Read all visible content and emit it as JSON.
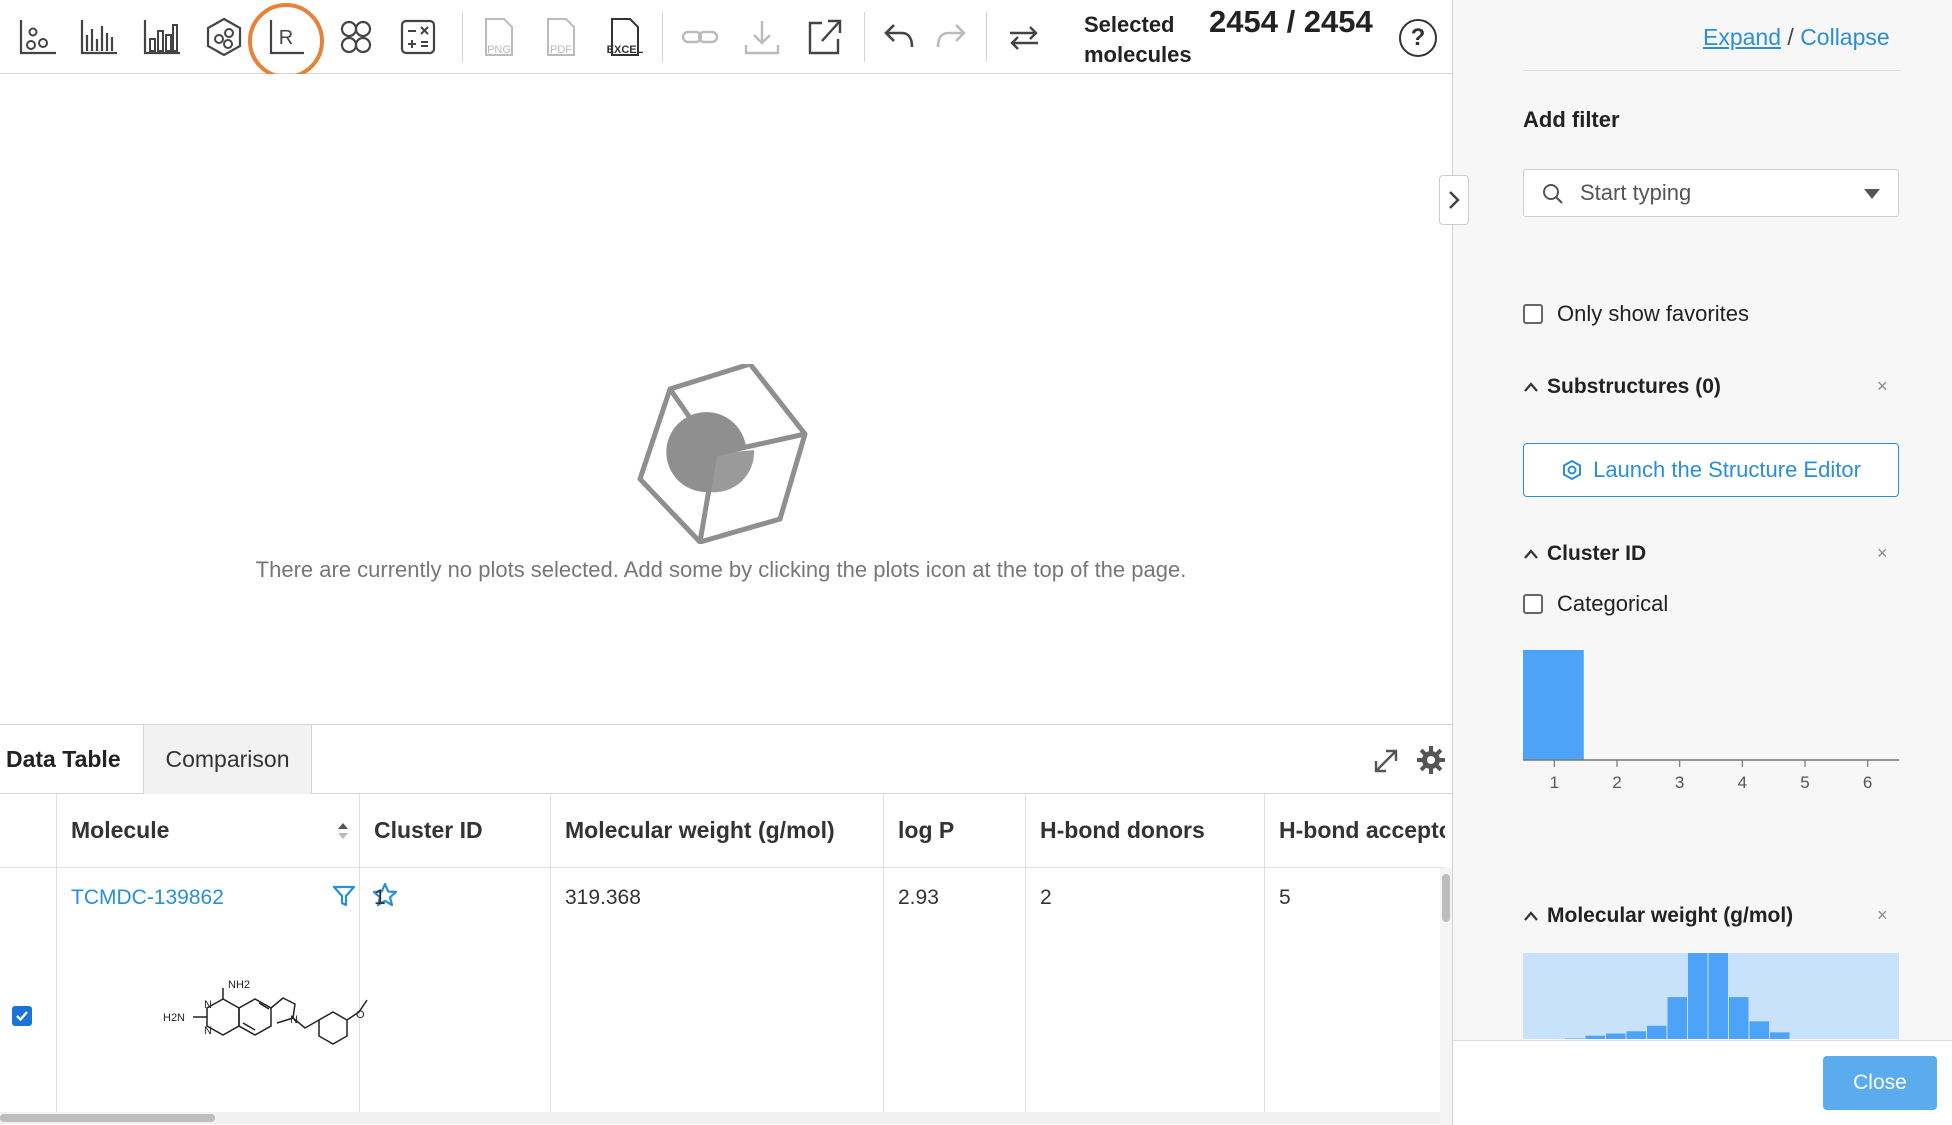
{
  "toolbar": {
    "selected_label": "Selected molecules",
    "selected_count": "2454 / 2454",
    "help": "?",
    "export_png": "PNG",
    "export_pdf": "PDF",
    "export_excel": "EXCEL",
    "r_label": "R",
    "icons": [
      "scatter-plot-icon",
      "histogram-icon",
      "bar-chart-icon",
      "cluster-icon",
      "r-script-icon",
      "venn-icon",
      "calculator-icon",
      "png-icon",
      "pdf-icon",
      "excel-icon",
      "link-icon",
      "download-icon",
      "external-link-icon",
      "undo-icon",
      "redo-icon",
      "swap-icon",
      "help-icon"
    ]
  },
  "plot_area": {
    "empty_message": "There are currently no plots selected. Add some by clicking the plots icon at the top of the page."
  },
  "table": {
    "tabs": [
      {
        "label": "Data Table",
        "active": true
      },
      {
        "label": "Comparison",
        "active": false
      }
    ],
    "columns": [
      "Molecule",
      "Cluster ID",
      "Molecular weight (g/mol)",
      "log P",
      "H-bond donors",
      "H-bond accepto"
    ],
    "rows": [
      {
        "checked": true,
        "molecule_id": "TCMDC-139862",
        "cluster_id": "1",
        "molecular_weight": "319.368",
        "log_p": "2.93",
        "hbond_donors": "2",
        "hbond_acceptors": "5",
        "structure_labels": {
          "nh2": "NH2",
          "h2n": "H2N",
          "n": "N",
          "o": "O"
        }
      }
    ]
  },
  "panel": {
    "expand": "Expand",
    "slash": " / ",
    "collapse": "Collapse",
    "add_filter": "Add filter",
    "filter_placeholder": "Start typing",
    "only_favorites": "Only show favorites",
    "substructures_title": "Substructures (0)",
    "launch_editor": "Launch the Structure Editor",
    "cluster_title": "Cluster ID",
    "categorical": "Categorical",
    "molweight_title": "Molecular weight (g/mol)",
    "close": "Close",
    "close_x": "×",
    "accent_color": "#2a8fd8",
    "histogram_color": "#4da3f7"
  },
  "chart_data": [
    {
      "type": "bar",
      "title": "Cluster ID",
      "categories": [
        "1",
        "2",
        "3",
        "4",
        "5",
        "6"
      ],
      "values": [
        1,
        0,
        0,
        0,
        0,
        0
      ],
      "xlabel": "",
      "ylabel": ""
    },
    {
      "type": "bar",
      "title": "Molecular weight (g/mol)",
      "values": [
        0.5,
        3,
        5,
        7,
        12,
        38,
        78,
        78,
        38,
        16,
        6
      ],
      "xlabel": "",
      "ylabel": ""
    }
  ]
}
